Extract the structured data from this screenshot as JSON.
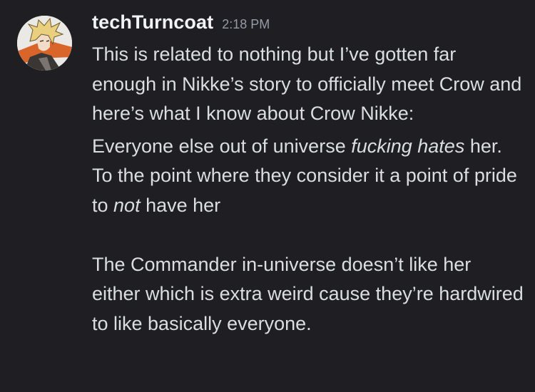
{
  "message": {
    "username": "techTurncoat",
    "timestamp": "2:18 PM",
    "avatar_icon": "anime-character-avatar",
    "paragraph1": "This is related to nothing but I’ve gotten far enough in Nikke’s story to officially meet Crow and here’s what I know about Crow Nikke:",
    "paragraph2": {
      "part1": "Everyone else out of universe ",
      "emph1": "fucking hates",
      "part2": " her. To the point where they consider it a point of pride to ",
      "emph2": "not",
      "part3": " have her"
    },
    "paragraph3": "The Commander in-universe doesn’t like her either which is extra weird cause they’re hardwired to like basically everyone."
  },
  "colors": {
    "background": "#1f1f23",
    "username": "#f2f3f5",
    "timestamp": "#949ba4",
    "text": "#dbdee1"
  }
}
